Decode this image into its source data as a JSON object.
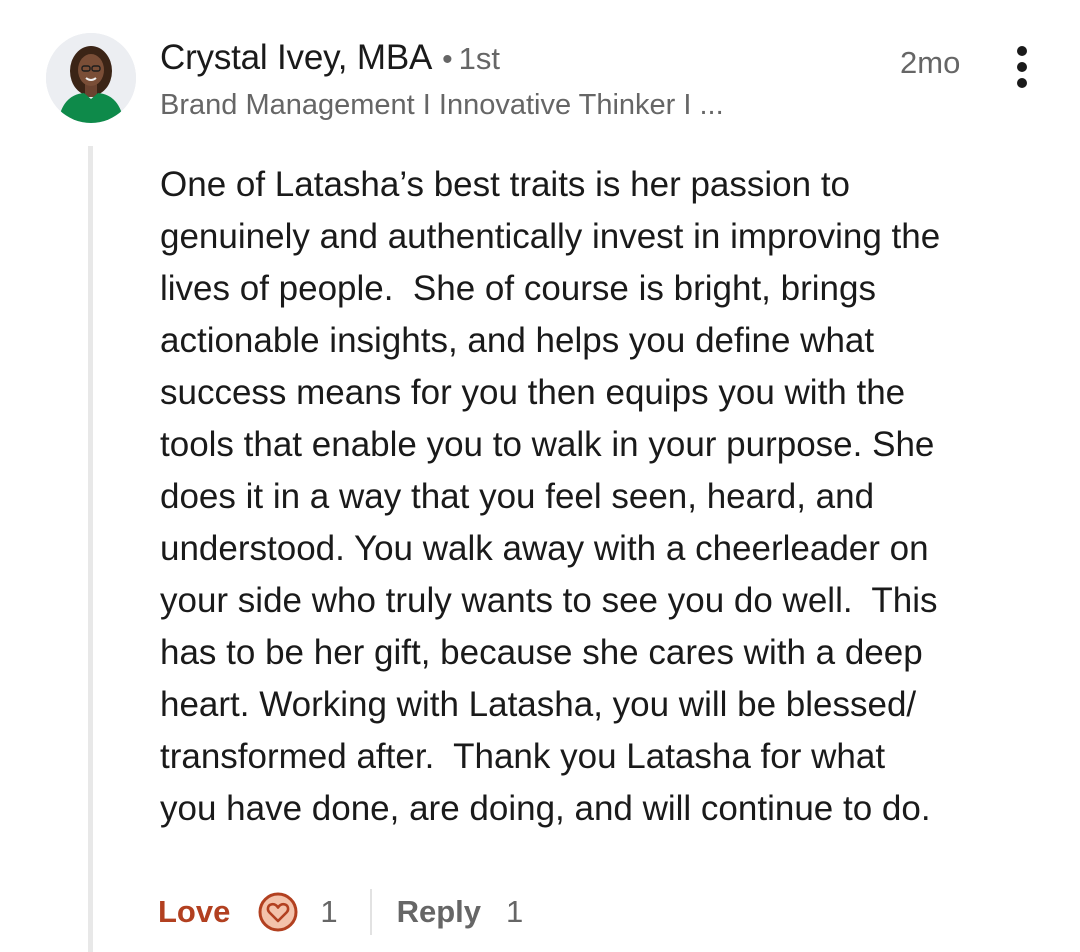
{
  "comment": {
    "author": {
      "name": "Crystal Ivey, MBA",
      "degree_separator": "•",
      "degree": "1st",
      "headline": "Brand Management I Innovative Thinker I ..."
    },
    "timestamp": "2mo",
    "body_lines": [
      "One of Latasha’s best traits is her passion to",
      "genuinely and authentically invest in improving the",
      "lives of people.  She of course is bright, brings",
      "actionable insights, and helps you define what",
      "success means for you then equips you with the",
      "tools that enable you to walk in your purpose. She",
      "does it in a way that you feel seen, heard, and",
      "understood. You walk away with a cheerleader on",
      "your side who truly wants to see you do well.  This",
      "has to be her gift, because she cares with a deep",
      "heart. Working with Latasha, you will be blessed/",
      "transformed after.  Thank you Latasha for what",
      "you have done, are doing, and will continue to do."
    ],
    "actions": {
      "reaction_label": "Love",
      "reaction_icon": "love-heart-icon",
      "reaction_count": "1",
      "reply_label": "Reply",
      "reply_count": "1"
    }
  },
  "icons": {
    "more": "more-options-vertical-icon",
    "avatar": "profile-photo"
  },
  "colors": {
    "love_accent": "#b24020",
    "love_badge_bg": "#f3c2ab",
    "secondary_text": "#666666",
    "primary_text": "#1a1a1a",
    "avatar_dress": "#0e8a4a"
  }
}
